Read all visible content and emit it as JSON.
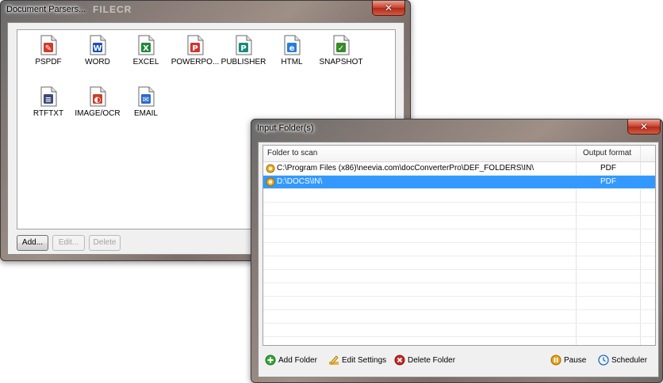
{
  "parsers_window": {
    "title": "Document Parsers...",
    "watermark": "FILECR",
    "close_glyph": "✕",
    "parsers": [
      {
        "label": "PSPDF",
        "icon": "pdf-doc-icon",
        "color": "#d23a2a",
        "glyph": "✎"
      },
      {
        "label": "WORD",
        "icon": "word-doc-icon",
        "color": "#1f4fb5",
        "glyph": "W"
      },
      {
        "label": "EXCEL",
        "icon": "excel-doc-icon",
        "color": "#1e8a3a",
        "glyph": "X"
      },
      {
        "label": "POWERPO...",
        "icon": "powerpoint-doc-icon",
        "color": "#d0342c",
        "glyph": "P"
      },
      {
        "label": "PUBLISHER",
        "icon": "publisher-doc-icon",
        "color": "#1a8a7a",
        "glyph": "P"
      },
      {
        "label": "HTML",
        "icon": "html-doc-icon",
        "color": "#2a7ed8",
        "glyph": "e"
      },
      {
        "label": "SNAPSHOT",
        "icon": "snapshot-doc-icon",
        "color": "#3a8a2a",
        "glyph": "✓"
      },
      {
        "label": "RTFTXT",
        "icon": "rtftxt-doc-icon",
        "color": "#3b4a7a",
        "glyph": "≡"
      },
      {
        "label": "IMAGE/OCR",
        "icon": "image-ocr-doc-icon",
        "color": "#c8402a",
        "glyph": "◐"
      },
      {
        "label": "EMAIL",
        "icon": "email-doc-icon",
        "color": "#2a6ac8",
        "glyph": "✉"
      }
    ],
    "buttons": {
      "add": "Add...",
      "edit": "Edit...",
      "delete": "Delete"
    }
  },
  "input_window": {
    "title": "Input Folder(s)",
    "close_glyph": "✕",
    "columns": {
      "folder": "Folder to scan",
      "format": "Output format"
    },
    "rows": [
      {
        "path": "C:\\Program Files (x86)\\neevia.com\\docConverterPro\\DEF_FOLDERS\\IN\\",
        "format": "PDF",
        "selected": false
      },
      {
        "path": "D:\\DOCS\\IN\\",
        "format": "PDF",
        "selected": true
      }
    ],
    "toolbar": {
      "add_folder": "Add Folder",
      "edit_settings": "Edit Settings",
      "delete_folder": "Delete Folder",
      "pause": "Pause",
      "scheduler": "Scheduler"
    }
  },
  "colors": {
    "selection": "#3399ff",
    "close_button": "#c7402d"
  }
}
